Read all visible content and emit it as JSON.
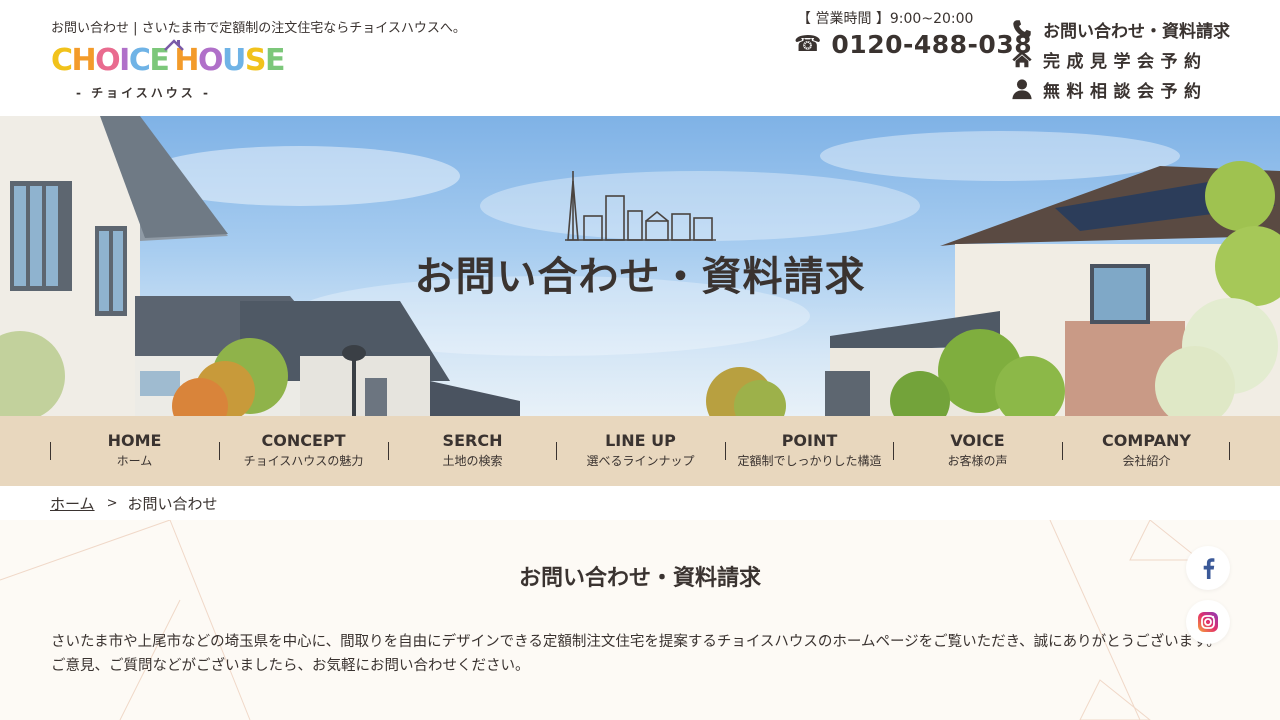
{
  "header": {
    "tagline": "お問い合わせ | さいたま市で定額制の注文住宅ならチョイスハウスへ。",
    "logo_text": "CHOICE HOUSE",
    "logo_sub": "- チョイスハウス -",
    "hours": "【 営業時間 】9:00~20:00",
    "phone": "0120-488-038",
    "links": [
      {
        "label": "お問い合わせ・資料請求",
        "icon": "phone-icon"
      },
      {
        "label": "完成見学会予約",
        "icon": "home-icon"
      },
      {
        "label": "無料相談会予約",
        "icon": "person-icon"
      }
    ]
  },
  "hero": {
    "title": "お問い合わせ・資料請求"
  },
  "nav": [
    {
      "en": "HOME",
      "ja": "ホーム"
    },
    {
      "en": "CONCEPT",
      "ja": "チョイスハウスの魅力"
    },
    {
      "en": "SERCH",
      "ja": "土地の検索"
    },
    {
      "en": "LINE UP",
      "ja": "選べるラインナップ"
    },
    {
      "en": "POINT",
      "ja": "定額制でしっかりした構造"
    },
    {
      "en": "VOICE",
      "ja": "お客様の声"
    },
    {
      "en": "COMPANY",
      "ja": "会社紹介"
    }
  ],
  "breadcrumb": {
    "home": "ホーム",
    "current": "お問い合わせ"
  },
  "content": {
    "title": "お問い合わせ・資料請求",
    "paragraph1": "さいたま市や上尾市などの埼玉県を中心に、間取りを自由にデザインできる定額制注文住宅を提案するチョイスハウスのホームページをご覧いただき、誠にありがとうございます。",
    "paragraph2": "ご意見、ご質問などがございましたら、お気軽にお問い合わせください。"
  },
  "colors": {
    "nav_bg": "#e8d7be",
    "content_bg": "#fdfaf5",
    "text": "#3a3330",
    "facebook": "#3b5998"
  }
}
